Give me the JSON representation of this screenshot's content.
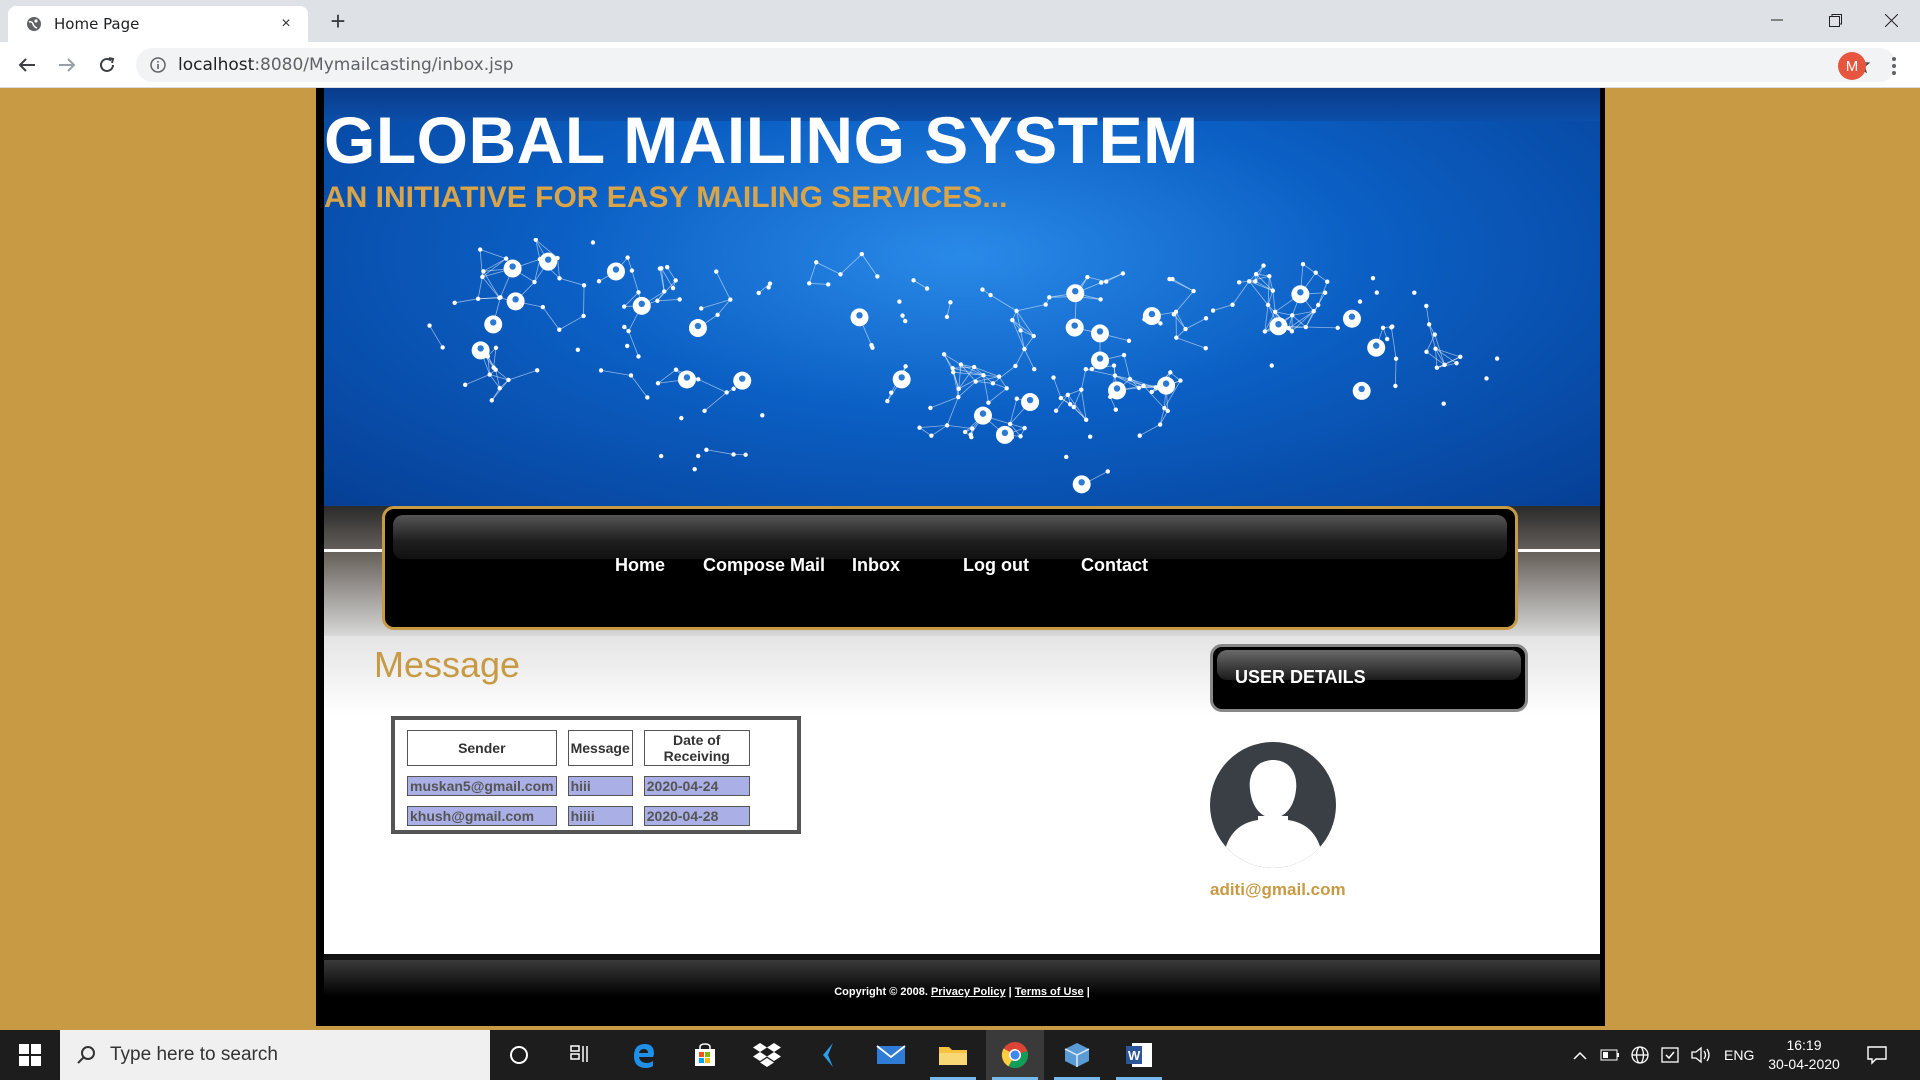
{
  "browser": {
    "tab_title": "Home Page",
    "tab_close": "×",
    "new_tab": "+",
    "url_host": "localhost",
    "url_path": ":8080/Mymailcasting/inbox.jsp",
    "profile_initial": "M"
  },
  "site": {
    "title": "GLOBAL MAILING SYSTEM",
    "subtitle": "AN INITIATIVE FOR EASY MAILING SERVICES..."
  },
  "nav": {
    "items": [
      {
        "label": "Home"
      },
      {
        "label": "Compose Mail"
      },
      {
        "label": "Inbox"
      },
      {
        "label": "Log out"
      },
      {
        "label": "Contact"
      }
    ]
  },
  "messages": {
    "heading": "Message",
    "columns": [
      "Sender",
      "Message",
      "Date of Receiving"
    ],
    "rows": [
      [
        "muskan5@gmail.com",
        "hiii",
        "2020-04-24"
      ],
      [
        "khush@gmail.com",
        "hiiii",
        "2020-04-28"
      ]
    ]
  },
  "user": {
    "box_label": "USER DETAILS",
    "email": "aditi@gmail.com"
  },
  "footer": {
    "copyright": "Copyright © 2008.",
    "privacy": "Privacy Policy",
    "sep": "|",
    "terms": "Terms of Use"
  },
  "taskbar": {
    "search_placeholder": "Type here to search",
    "lang": "ENG",
    "time": "16:19",
    "date": "30-04-2020",
    "icons": [
      "cortana-icon",
      "task-view-icon",
      "edge-icon",
      "store-icon",
      "dropbox-icon",
      "visual-studio-icon",
      "mail-icon",
      "file-explorer-icon",
      "chrome-icon",
      "virtualbox-icon",
      "word-icon"
    ]
  },
  "colors": {
    "page_bg": "#c99a44",
    "accent_gold": "#c99a44",
    "table_cell": "#aab0e6",
    "banner_blue": "#0b5fc4"
  }
}
